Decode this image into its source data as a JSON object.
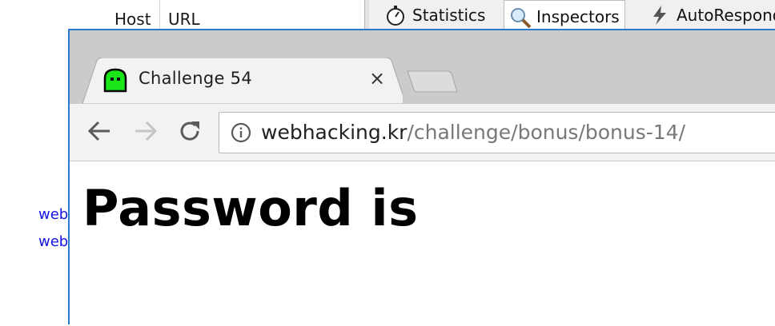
{
  "background_app": {
    "columns": {
      "host": "Host",
      "url": "URL"
    },
    "session_links": [
      "web",
      "web"
    ],
    "tabs": [
      {
        "label": "Statistics",
        "icon": "stopwatch-icon",
        "selected": false
      },
      {
        "label": "Inspectors",
        "icon": "magnifier-icon",
        "selected": true
      },
      {
        "label": "AutoResponder",
        "icon": "lightning-icon",
        "selected": false
      }
    ]
  },
  "browser": {
    "tab": {
      "title": "Challenge 54",
      "favicon": "green-ghost-icon",
      "close": "×"
    },
    "address": {
      "host": "webhacking.kr",
      "path": "/challenge/bonus/bonus-14/"
    }
  },
  "page": {
    "heading": "Password is"
  },
  "colors": {
    "window_border": "#2b79d0",
    "tabstrip": "#cbcbcb",
    "favicon": "#19e619",
    "link": "#1515e6"
  }
}
